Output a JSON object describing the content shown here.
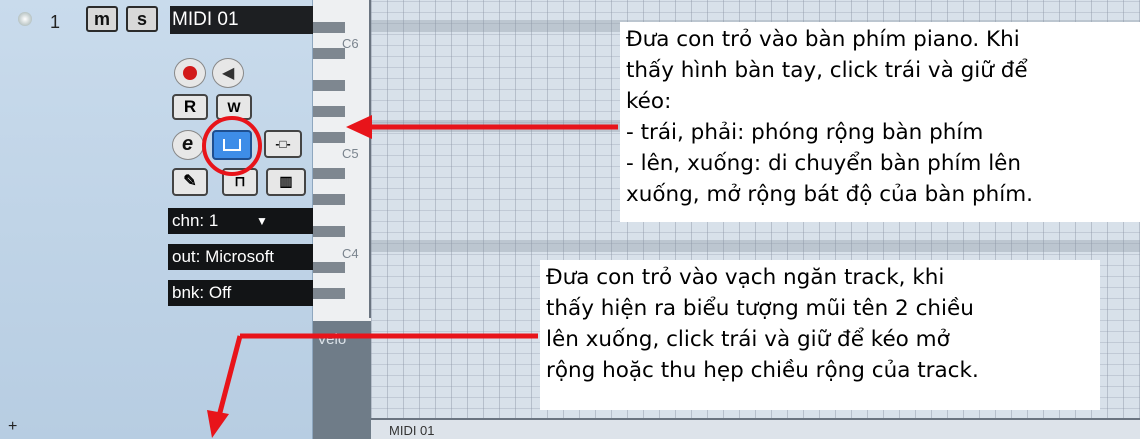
{
  "track": {
    "number": "1",
    "mute_label": "m",
    "solo_label": "s",
    "name": "MIDI 01",
    "read_label": "R",
    "write_label": "W",
    "edit_label": "e",
    "channel": "chn: 1",
    "output": "out: Microsoft",
    "bank": "bnk: Off",
    "add_label": "+"
  },
  "keyboard": {
    "octave_labels": [
      "C6",
      "C5",
      "C4"
    ],
    "velocity_label": "Velo"
  },
  "editor": {
    "tab_label": "MIDI 01"
  },
  "callouts": {
    "keyboard_tip": [
      "Đưa con trỏ vào bàn phím piano. Khi",
      "thấy hình bàn tay, click trái và giữ để",
      "kéo:",
      "- trái, phải: phóng rộng bàn phím",
      "- lên, xuống: di chuyển bàn phím lên",
      "xuống, mở rộng bát độ của bàn phím."
    ],
    "divider_tip": [
      "Đưa con trỏ vào vạch ngăn track, khi",
      "thấy hiện ra biểu tượng mũi tên 2 chiều",
      "lên xuống, click trái và giữ để kéo mở",
      "rộng hoặc thu hẹp chiều rộng của track."
    ]
  },
  "colors": {
    "annotation_red": "#e8141a",
    "panel_bg": "#bcd1e4",
    "name_bg": "#1d1f22"
  }
}
